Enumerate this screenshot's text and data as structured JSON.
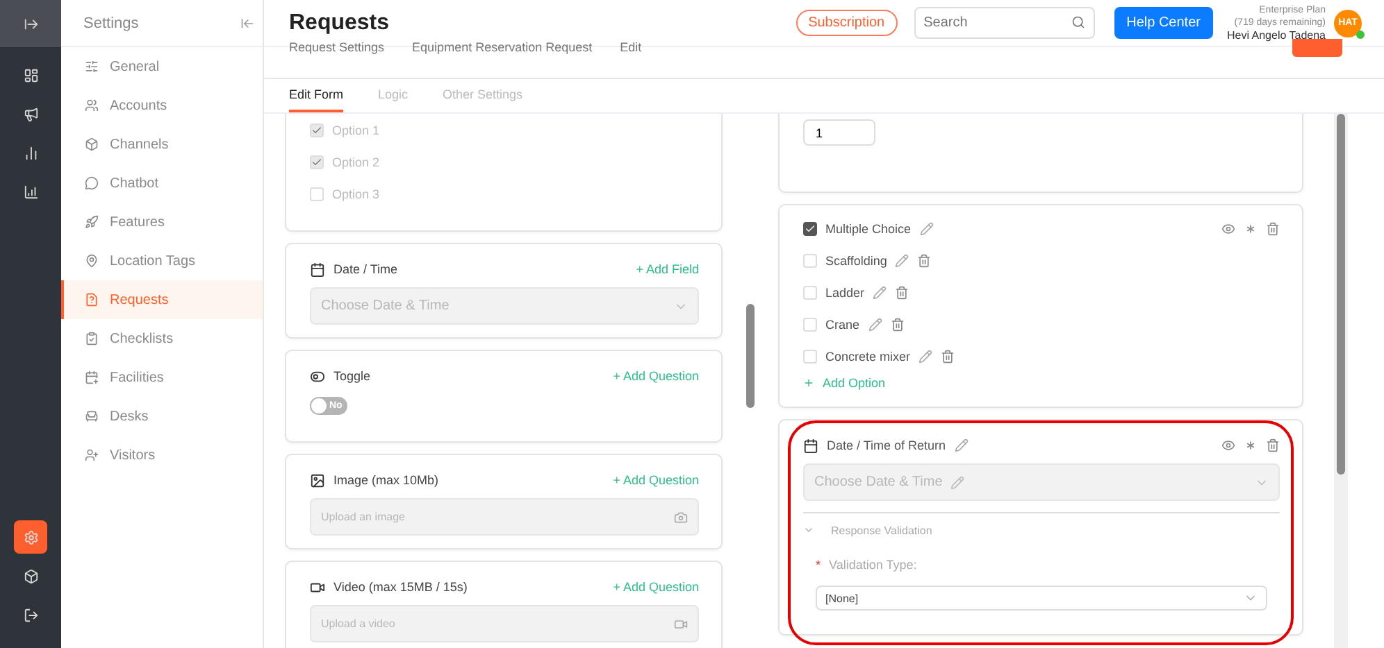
{
  "rail": {
    "top": [
      {
        "selected": false
      },
      {
        "selected": false
      },
      {
        "selected": false
      },
      {
        "selected": false
      }
    ],
    "bottom": [
      {
        "selected": true
      },
      {
        "selected": false
      },
      {
        "selected": false
      }
    ]
  },
  "sidebar": {
    "title": "Settings",
    "items": [
      {
        "label": "General",
        "selected": false
      },
      {
        "label": "Accounts",
        "selected": false
      },
      {
        "label": "Channels",
        "selected": false
      },
      {
        "label": "Chatbot",
        "selected": false
      },
      {
        "label": "Features",
        "selected": false
      },
      {
        "label": "Location Tags",
        "selected": false
      },
      {
        "label": "Requests",
        "selected": true
      },
      {
        "label": "Checklists",
        "selected": false
      },
      {
        "label": "Facilities",
        "selected": false
      },
      {
        "label": "Desks",
        "selected": false
      },
      {
        "label": "Visitors",
        "selected": false
      }
    ]
  },
  "header": {
    "title": "Requests",
    "subscription": "Subscription",
    "search": {
      "placeholder": "Search"
    },
    "help": "Help Center",
    "plan": "Enterprise Plan",
    "days": "(719 days remaining)",
    "user": "Hevi Angelo Tadena",
    "avatar": "HAT",
    "online": true
  },
  "breadcrumb": [
    "Request Settings",
    "Equipment Reservation Request",
    "Edit"
  ],
  "tabs": [
    {
      "label": "Edit Form",
      "selected": true
    },
    {
      "label": "Logic",
      "selected": false
    },
    {
      "label": "Other Settings",
      "selected": false
    }
  ],
  "left_cards": [
    {
      "kind": "options",
      "options": [
        {
          "label": "Option 1",
          "checked": true
        },
        {
          "label": "Option 2",
          "checked": true
        },
        {
          "label": "Option 3",
          "checked": false
        }
      ]
    },
    {
      "kind": "datetime",
      "title": "Date / Time",
      "action": "+ Add Field",
      "placeholder": "Choose Date & Time"
    },
    {
      "kind": "toggle",
      "title": "Toggle",
      "action": "+ Add Question",
      "toggle": {
        "label": "No",
        "on": false
      }
    },
    {
      "kind": "image",
      "title": "Image (max 10Mb)",
      "action": "+ Add Question",
      "placeholder": "Upload an image"
    },
    {
      "kind": "video",
      "title": "Video (max 15MB / 15s)",
      "action": "+ Add Question",
      "placeholder": "Upload a video"
    }
  ],
  "right_cards": [
    {
      "kind": "number",
      "value": "1"
    },
    {
      "kind": "choice",
      "title": "Multiple Choice",
      "checked": true,
      "options": [
        {
          "label": "Scaffolding",
          "checked": false
        },
        {
          "label": "Ladder",
          "checked": false
        },
        {
          "label": "Crane",
          "checked": false
        },
        {
          "label": "Concrete mixer",
          "checked": false
        }
      ],
      "add": "Add Option"
    },
    {
      "kind": "datetime",
      "title": "Date / Time of Return",
      "placeholder": "Choose Date & Time",
      "highlighted": true,
      "validation": {
        "label": "Response Validation",
        "expanded": true,
        "field_label": "Validation Type:",
        "required": true,
        "required_mark": "*",
        "value": "[None]"
      }
    }
  ]
}
